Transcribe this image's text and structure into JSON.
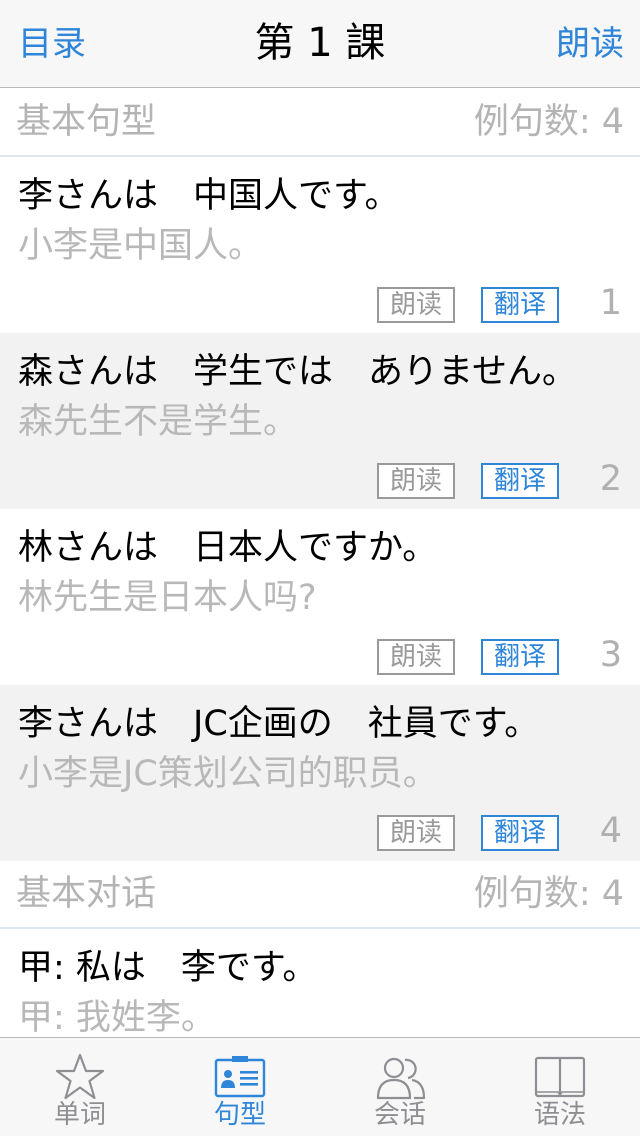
{
  "nav": {
    "back_label": "目录",
    "title": "第 1 課",
    "read_label": "朗读"
  },
  "sections": [
    {
      "title": "基本句型",
      "count_label": "例句数: 4",
      "rows": [
        {
          "jp": "李さんは　中国人です。",
          "cn": "小李是中国人。",
          "read": "朗读",
          "translate": "翻译",
          "num": "1"
        },
        {
          "jp": "森さんは　学生では　ありません。",
          "cn": "森先生不是学生。",
          "read": "朗读",
          "translate": "翻译",
          "num": "2"
        },
        {
          "jp": "林さんは　日本人ですか。",
          "cn": "林先生是日本人吗?",
          "read": "朗读",
          "translate": "翻译",
          "num": "3"
        },
        {
          "jp": "李さんは　JC企画の　社員です。",
          "cn": "小李是JC策划公司的职员。",
          "read": "朗读",
          "translate": "翻译",
          "num": "4"
        }
      ]
    },
    {
      "title": "基本对话",
      "count_label": "例句数: 4",
      "rows": [
        {
          "jp": "甲: 私は　李です。",
          "cn": "甲: 我姓李。"
        }
      ]
    }
  ],
  "tabs": [
    {
      "label": "单词",
      "icon": "star-icon"
    },
    {
      "label": "句型",
      "icon": "contact-card-icon"
    },
    {
      "label": "会话",
      "icon": "people-icon"
    },
    {
      "label": "语法",
      "icon": "book-icon"
    }
  ],
  "colors": {
    "accent": "#2f86d9",
    "muted": "#b4b4b4",
    "alt_row": "#f2f2f2"
  }
}
